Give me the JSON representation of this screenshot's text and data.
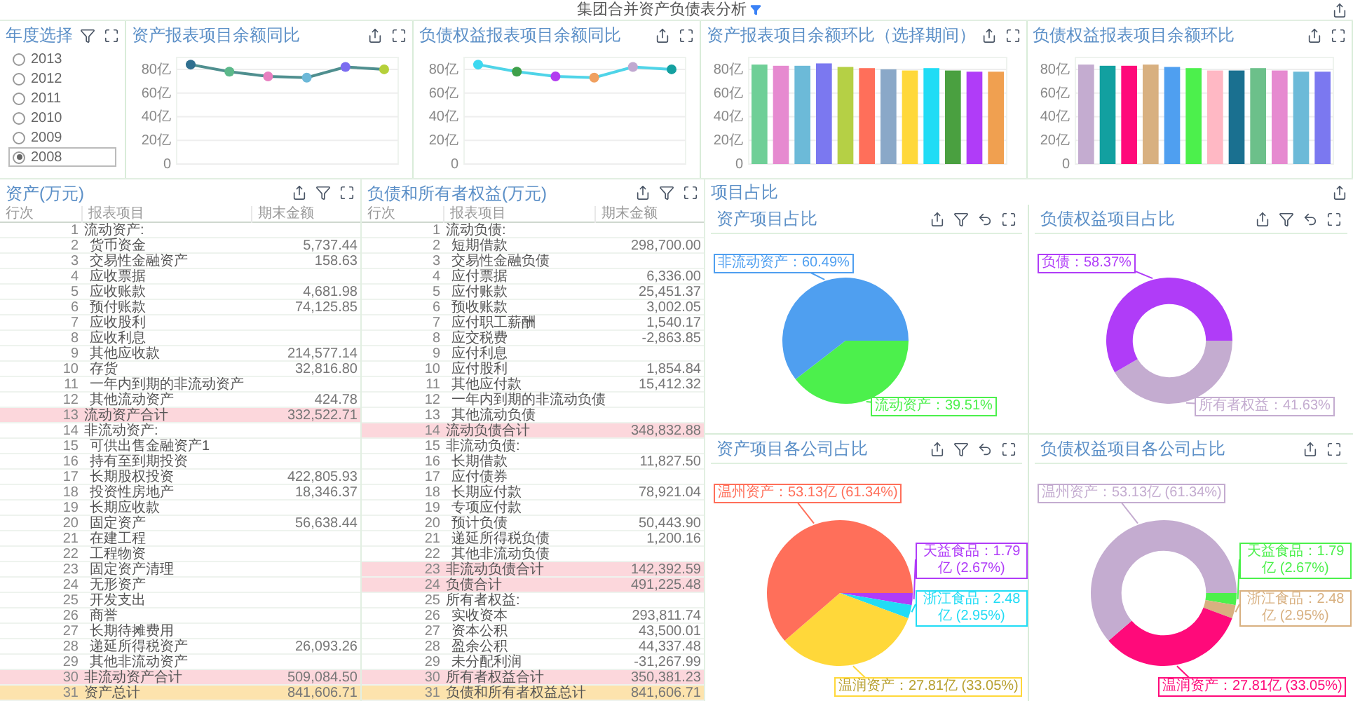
{
  "header": {
    "title": "集团合并资产负债表分析"
  },
  "year_selector": {
    "title": "年度选择",
    "options": [
      {
        "label": "2013",
        "selected": false
      },
      {
        "label": "2012",
        "selected": false
      },
      {
        "label": "2011",
        "selected": false
      },
      {
        "label": "2010",
        "selected": false
      },
      {
        "label": "2009",
        "selected": false
      },
      {
        "label": "2008",
        "selected": true
      }
    ]
  },
  "line_charts": [
    {
      "title": "资产报表项目余额同比",
      "chart_data": {
        "type": "line",
        "ylim": [
          0,
          90
        ],
        "yticks": [
          {
            "value": 0,
            "label": "0"
          },
          {
            "value": 20,
            "label": "20亿"
          },
          {
            "value": 40,
            "label": "40亿"
          },
          {
            "value": 60,
            "label": "60亿"
          },
          {
            "value": 80,
            "label": "80亿"
          }
        ],
        "grid": true,
        "series": [
          {
            "color": "#4f8f8f",
            "marker": true,
            "values": [
              84,
              78,
              74,
              73,
              82,
              80
            ]
          }
        ]
      }
    },
    {
      "title": "负债权益报表项目余额同比",
      "chart_data": {
        "type": "line",
        "ylim": [
          0,
          90
        ],
        "yticks": [
          {
            "value": 0,
            "label": "0"
          },
          {
            "value": 20,
            "label": "20亿"
          },
          {
            "value": 40,
            "label": "40亿"
          },
          {
            "value": 60,
            "label": "60亿"
          },
          {
            "value": 80,
            "label": "80亿"
          }
        ],
        "grid": true,
        "series": [
          {
            "color": "#4fd4e8",
            "marker": true,
            "values": [
              84,
              78,
              74,
              73,
              82,
              80
            ]
          }
        ]
      }
    }
  ],
  "bar_charts": [
    {
      "title": "资产报表项目余额环比（选择期间）",
      "chart_data": {
        "type": "bar",
        "ylim": [
          0,
          90
        ],
        "yticks": [
          {
            "value": 0,
            "label": "0"
          },
          {
            "value": 20,
            "label": "20亿"
          },
          {
            "value": 40,
            "label": "40亿"
          },
          {
            "value": 60,
            "label": "60亿"
          },
          {
            "value": 80,
            "label": "80亿"
          }
        ],
        "grid": true,
        "values": [
          84,
          83,
          83,
          85,
          82,
          81,
          80,
          79,
          81,
          79,
          78,
          78
        ]
      }
    },
    {
      "title": "负债权益报表项目余额环比",
      "chart_data": {
        "type": "bar",
        "ylim": [
          0,
          90
        ],
        "yticks": [
          {
            "value": 0,
            "label": "0"
          },
          {
            "value": 20,
            "label": "20亿"
          },
          {
            "value": 40,
            "label": "40亿"
          },
          {
            "value": 60,
            "label": "60亿"
          },
          {
            "value": 80,
            "label": "80亿"
          }
        ],
        "grid": true,
        "values": [
          84,
          83,
          83,
          84,
          82,
          81,
          79,
          79,
          81,
          79,
          78,
          78
        ]
      }
    }
  ],
  "tables": [
    {
      "title": "资产(万元)",
      "columns": [
        "行次",
        "报表项目",
        "期末金额"
      ],
      "rows": [
        {
          "no": "1",
          "item": "流动资产:",
          "kind": "section"
        },
        {
          "no": "2",
          "item": "货币资金",
          "amount": "5,737.44",
          "kind": "item"
        },
        {
          "no": "3",
          "item": "交易性金融资产",
          "amount": "158.63",
          "kind": "item"
        },
        {
          "no": "4",
          "item": "应收票据",
          "kind": "item"
        },
        {
          "no": "5",
          "item": "应收账款",
          "amount": "4,681.98",
          "kind": "item"
        },
        {
          "no": "6",
          "item": "预付账款",
          "amount": "74,125.85",
          "kind": "item"
        },
        {
          "no": "7",
          "item": "应收股利",
          "kind": "item"
        },
        {
          "no": "8",
          "item": "应收利息",
          "kind": "item"
        },
        {
          "no": "9",
          "item": "其他应收款",
          "amount": "214,577.14",
          "kind": "item"
        },
        {
          "no": "10",
          "item": "存货",
          "amount": "32,816.80",
          "kind": "item"
        },
        {
          "no": "11",
          "item": "一年内到期的非流动资产",
          "kind": "item"
        },
        {
          "no": "12",
          "item": "其他流动资产",
          "amount": "424.78",
          "kind": "item"
        },
        {
          "no": "13",
          "item": "流动资产合计",
          "amount": "332,522.71",
          "kind": "subtotal"
        },
        {
          "no": "14",
          "item": "非流动资产:",
          "kind": "section"
        },
        {
          "no": "15",
          "item": "可供出售金融资产1",
          "kind": "item"
        },
        {
          "no": "16",
          "item": "持有至到期投资",
          "kind": "item"
        },
        {
          "no": "17",
          "item": "长期股权投资",
          "amount": "422,805.93",
          "kind": "item"
        },
        {
          "no": "18",
          "item": "投资性房地产",
          "amount": "18,346.37",
          "kind": "item"
        },
        {
          "no": "19",
          "item": "长期应收款",
          "kind": "item"
        },
        {
          "no": "20",
          "item": "固定资产",
          "amount": "56,638.44",
          "kind": "item"
        },
        {
          "no": "21",
          "item": "在建工程",
          "kind": "item"
        },
        {
          "no": "22",
          "item": "工程物资",
          "kind": "item"
        },
        {
          "no": "23",
          "item": "固定资产清理",
          "kind": "item"
        },
        {
          "no": "24",
          "item": "无形资产",
          "kind": "item"
        },
        {
          "no": "25",
          "item": "开发支出",
          "kind": "item"
        },
        {
          "no": "26",
          "item": "商誉",
          "kind": "item"
        },
        {
          "no": "27",
          "item": "长期待摊费用",
          "kind": "item"
        },
        {
          "no": "28",
          "item": "递延所得税资产",
          "amount": "26,093.26",
          "kind": "item"
        },
        {
          "no": "29",
          "item": "其他非流动资产",
          "kind": "item"
        },
        {
          "no": "30",
          "item": "非流动资产合计",
          "amount": "509,084.50",
          "kind": "subtotal"
        },
        {
          "no": "31",
          "item": "资产总计",
          "amount": "841,606.71",
          "kind": "total"
        }
      ]
    },
    {
      "title": "负债和所有者权益(万元)",
      "columns": [
        "行次",
        "报表项目",
        "期末金额"
      ],
      "rows": [
        {
          "no": "1",
          "item": "流动负债:",
          "kind": "section"
        },
        {
          "no": "2",
          "item": "短期借款",
          "amount": "298,700.00",
          "kind": "item"
        },
        {
          "no": "3",
          "item": "交易性金融负债",
          "kind": "item"
        },
        {
          "no": "4",
          "item": "应付票据",
          "amount": "6,336.00",
          "kind": "item"
        },
        {
          "no": "5",
          "item": "应付账款",
          "amount": "25,451.37",
          "kind": "item"
        },
        {
          "no": "6",
          "item": "预收账款",
          "amount": "3,002.05",
          "kind": "item"
        },
        {
          "no": "7",
          "item": "应付职工薪酬",
          "amount": "1,540.17",
          "kind": "item"
        },
        {
          "no": "8",
          "item": "应交税费",
          "amount": "-2,863.85",
          "kind": "item"
        },
        {
          "no": "9",
          "item": "应付利息",
          "kind": "item"
        },
        {
          "no": "10",
          "item": "应付股利",
          "amount": "1,854.84",
          "kind": "item"
        },
        {
          "no": "11",
          "item": "其他应付款",
          "amount": "15,412.32",
          "kind": "item"
        },
        {
          "no": "12",
          "item": "一年内到期的非流动负债",
          "kind": "item"
        },
        {
          "no": "13",
          "item": "其他流动负债",
          "kind": "item"
        },
        {
          "no": "14",
          "item": "流动负债合计",
          "amount": "348,832.88",
          "kind": "subtotal"
        },
        {
          "no": "15",
          "item": "非流动负债:",
          "kind": "section"
        },
        {
          "no": "16",
          "item": "长期借款",
          "amount": "11,827.50",
          "kind": "item"
        },
        {
          "no": "17",
          "item": "应付债券",
          "kind": "item"
        },
        {
          "no": "18",
          "item": "长期应付款",
          "amount": "78,921.04",
          "kind": "item"
        },
        {
          "no": "19",
          "item": "专项应付款",
          "kind": "item"
        },
        {
          "no": "20",
          "item": "预计负债",
          "amount": "50,443.90",
          "kind": "item"
        },
        {
          "no": "21",
          "item": "递延所得税负债",
          "amount": "1,200.16",
          "kind": "item"
        },
        {
          "no": "22",
          "item": "其他非流动负债",
          "kind": "item"
        },
        {
          "no": "23",
          "item": "非流动负债合计",
          "amount": "142,392.59",
          "kind": "subtotal"
        },
        {
          "no": "24",
          "item": "负债合计",
          "amount": "491,225.48",
          "kind": "subtotal"
        },
        {
          "no": "25",
          "item": "所有者权益:",
          "kind": "section"
        },
        {
          "no": "26",
          "item": "实收资本",
          "amount": "293,811.74",
          "kind": "item"
        },
        {
          "no": "27",
          "item": "资本公积",
          "amount": "43,500.01",
          "kind": "item"
        },
        {
          "no": "28",
          "item": "盈余公积",
          "amount": "44,337.48",
          "kind": "item"
        },
        {
          "no": "29",
          "item": "未分配利润",
          "amount": "-31,267.99",
          "kind": "item"
        },
        {
          "no": "30",
          "item": "所有者权益合计",
          "amount": "350,381.23",
          "kind": "subtotal"
        },
        {
          "no": "31",
          "item": "负债和所有者权益总计",
          "amount": "841,606.71",
          "kind": "total"
        }
      ]
    }
  ],
  "share_section": {
    "title": "项目占比",
    "panels": [
      {
        "title": "资产项目占比",
        "chart_data": {
          "type": "pie",
          "values": [
            39.51,
            60.49
          ],
          "colors": [
            "#4cf04c",
            "#4f9ff0"
          ],
          "value_labels": [
            "流动资产：39.51%",
            "非流动资产：60.49%"
          ]
        }
      },
      {
        "title": "负债权益项目占比",
        "chart_data": {
          "type": "donut",
          "values": [
            41.63,
            58.37
          ],
          "colors": [
            "#c4acd0",
            "#b03cf8"
          ],
          "value_labels": [
            "所有者权益：41.63%",
            "负债：58.37%"
          ]
        }
      },
      {
        "title": "资产项目各公司占比",
        "chart_data": {
          "type": "pie",
          "values": [
            2.67,
            2.95,
            33.05,
            61.34
          ],
          "colors": [
            "#b03cf8",
            "#20dcf5",
            "#ffd83a",
            "#ff6f5a"
          ],
          "value_labels": [
            "天益食品：1.79亿 (2.67%)",
            "浙江食品：2.48亿 (2.95%)",
            "温润资产：27.81亿 (33.05%)",
            "温州资产：53.13亿 (61.34%)"
          ]
        }
      },
      {
        "title": "负债权益项目各公司占比",
        "chart_data": {
          "type": "donut",
          "values": [
            2.67,
            2.95,
            33.05,
            61.34
          ],
          "colors": [
            "#4cf04c",
            "#d8b080",
            "#ff0a7a",
            "#c4acd0"
          ],
          "value_labels": [
            "天益食品：1.79亿 (2.67%)",
            "浙江食品：2.48亿 (2.95%)",
            "温润资产：27.81亿 (33.05%)",
            "温州资产：53.13亿 (61.34%)"
          ]
        }
      }
    ]
  }
}
